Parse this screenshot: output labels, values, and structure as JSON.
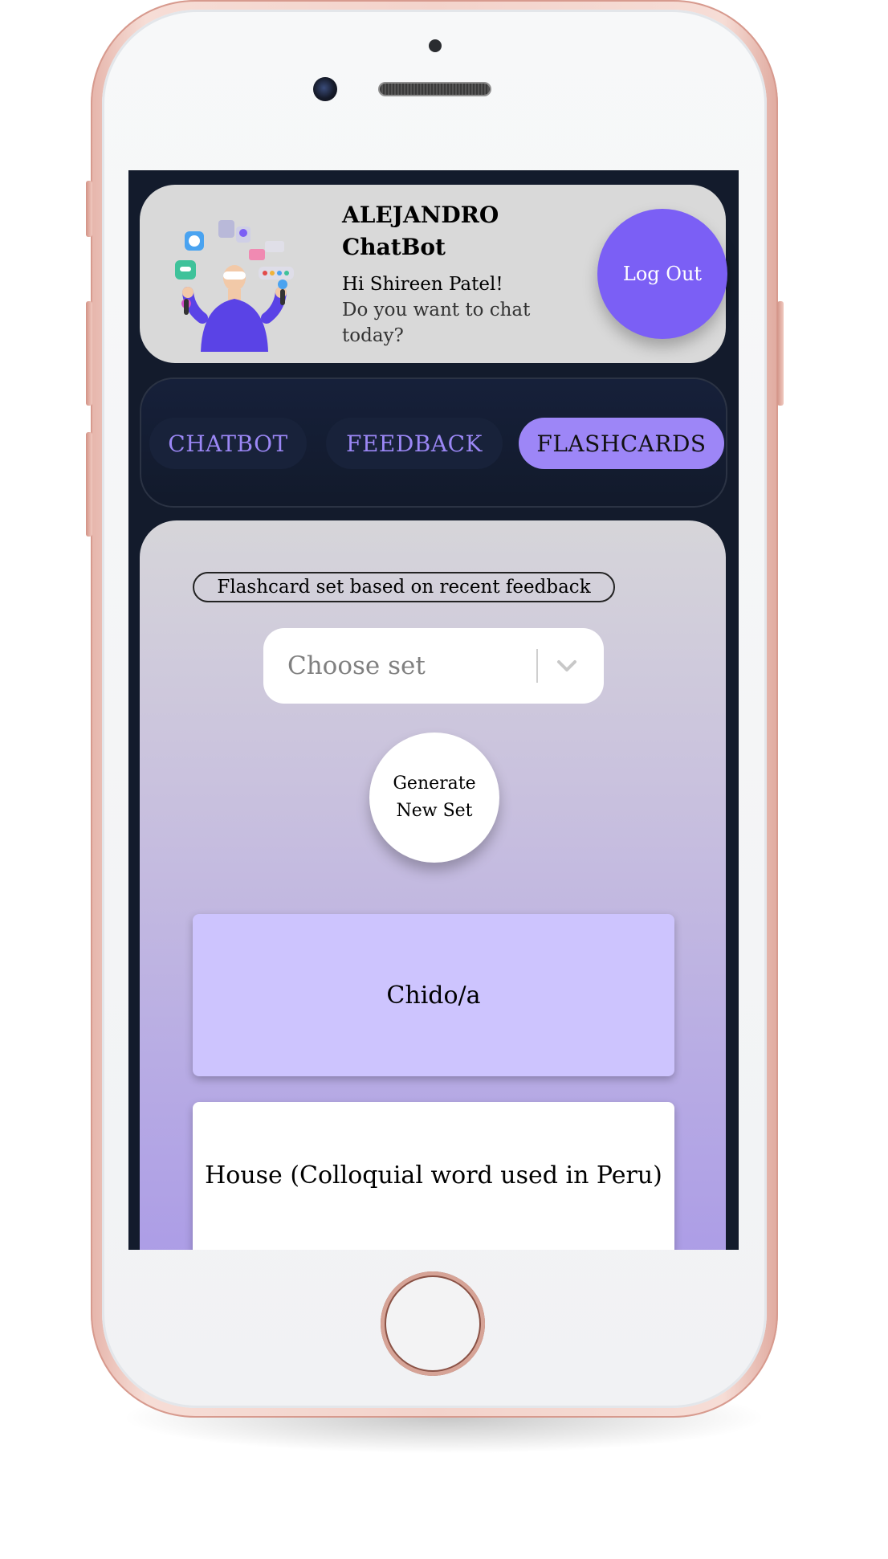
{
  "header": {
    "brand_line1": "ALEJANDRO",
    "brand_line2": "ChatBot",
    "greeting": "Hi Shireen Patel!",
    "greeting_sub": "Do you want to chat today?",
    "logout_label": "Log Out"
  },
  "tabs": [
    {
      "label": "CHATBOT",
      "active": false
    },
    {
      "label": "FEEDBACK",
      "active": false
    },
    {
      "label": "FLASHCARDS",
      "active": true
    }
  ],
  "flashcards": {
    "set_label": "Flashcard set based on recent feedback",
    "select_placeholder": "Choose set",
    "generate_label": "Generate New Set",
    "cards": [
      {
        "text": "Chido/a"
      },
      {
        "text": "House (Colloquial word used in Peru)"
      }
    ]
  },
  "colors": {
    "accent": "#7b5ff5",
    "active_tab": "#9d86f7",
    "card_front": "#cdc4fe",
    "screen_bg": "#131b2c"
  }
}
